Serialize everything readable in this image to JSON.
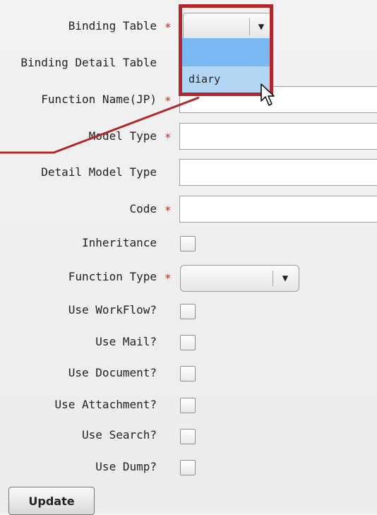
{
  "form": {
    "fields": {
      "binding_table": {
        "label": "Binding Table",
        "required": "*"
      },
      "binding_detail_table": {
        "label": "Binding Detail Table"
      },
      "function_name_jp": {
        "label": "Function Name(JP)",
        "required": "*",
        "value": ""
      },
      "model_type": {
        "label": "Model Type",
        "required": "*",
        "value": ""
      },
      "detail_model_type": {
        "label": "Detail Model Type",
        "value": ""
      },
      "code": {
        "label": "Code",
        "required": "*",
        "value": ""
      },
      "inheritance": {
        "label": "Inheritance",
        "checked": false
      },
      "function_type": {
        "label": "Function Type",
        "required": "*",
        "value": ""
      },
      "use_workflow": {
        "label": "Use WorkFlow?",
        "checked": false
      },
      "use_mail": {
        "label": "Use Mail?",
        "checked": false
      },
      "use_document": {
        "label": "Use Document?",
        "checked": false
      },
      "use_attachment": {
        "label": "Use Attachment?",
        "checked": false
      },
      "use_search": {
        "label": "Use Search?",
        "checked": false
      },
      "use_dump": {
        "label": "Use Dump?",
        "checked": false
      }
    },
    "binding_table_dropdown": {
      "options": [
        "",
        "diary"
      ],
      "open": true,
      "hovered_option": "diary"
    },
    "update_button": {
      "label": "Update"
    }
  },
  "colors": {
    "required": "#cc1f1f",
    "callout": "#b3262b",
    "dropdown_highlight": "#79b8f2",
    "dropdown_option": "#b4d6f5"
  },
  "icons": {
    "select_arrow": "dropdown-arrow-icon",
    "cursor": "mouse-pointer-icon"
  }
}
